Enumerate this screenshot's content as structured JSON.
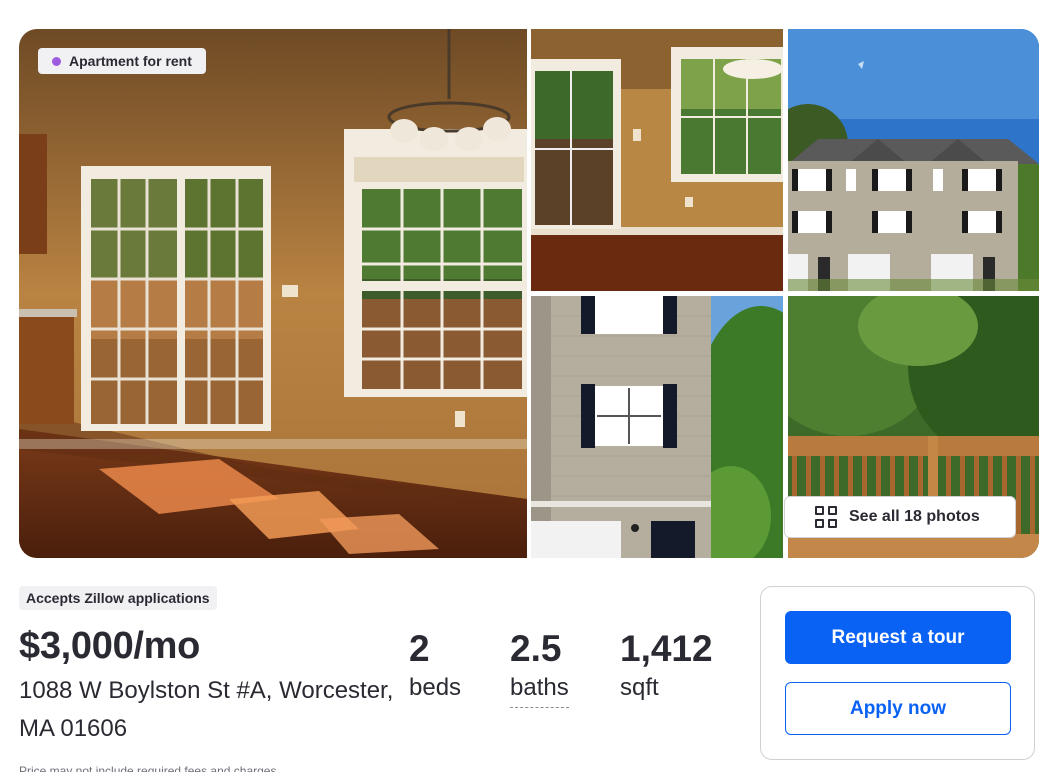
{
  "gallery": {
    "listing_type": "Apartment for rent",
    "see_all_label": "See all 18 photos",
    "badge_dot_color": "#9f5be0"
  },
  "listing": {
    "tag": "Accepts Zillow applications",
    "price": "$3,000/mo",
    "address_line1": "1088 W Boylston St #A, Worcester,",
    "address_line2": "MA 01606",
    "beds_value": "2",
    "beds_label": "beds",
    "baths_value": "2.5",
    "baths_label": "baths",
    "sqft_value": "1,412",
    "sqft_label": "sqft",
    "disclaimer": "Price may not include required fees and charges."
  },
  "actions": {
    "tour_label": "Request a tour",
    "apply_label": "Apply now",
    "accent_color": "#0a62f5"
  }
}
